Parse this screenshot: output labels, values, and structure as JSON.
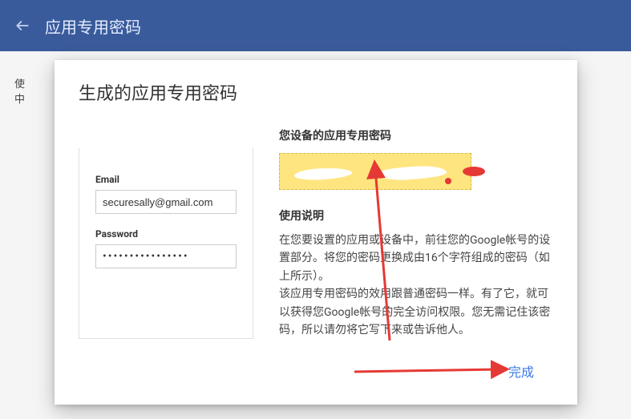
{
  "topbar": {
    "title": "应用专用密码"
  },
  "background": {
    "text_fragment_1": "使",
    "text_fragment_2": "中"
  },
  "dialog": {
    "title": "生成的应用专用密码",
    "left": {
      "email_label": "Email",
      "email_value": "securesally@gmail.com",
      "password_label": "Password",
      "password_masked": "••••••••••••••••"
    },
    "right": {
      "heading": "您设备的应用专用密码",
      "instructions_heading": "使用说明",
      "instructions_body": "在您要设置的应用或设备中，前往您的Google帐号的设置部分。将您的密码更换成由16个字符组成的密码（如上所示）。\n该应用专用密码的效用跟普通密码一样。有了它，就可以获得您Google帐号的完全访问权限。您无需记住该密码，所以请勿将它写下来或告诉他人。"
    },
    "done_label": "完成"
  }
}
